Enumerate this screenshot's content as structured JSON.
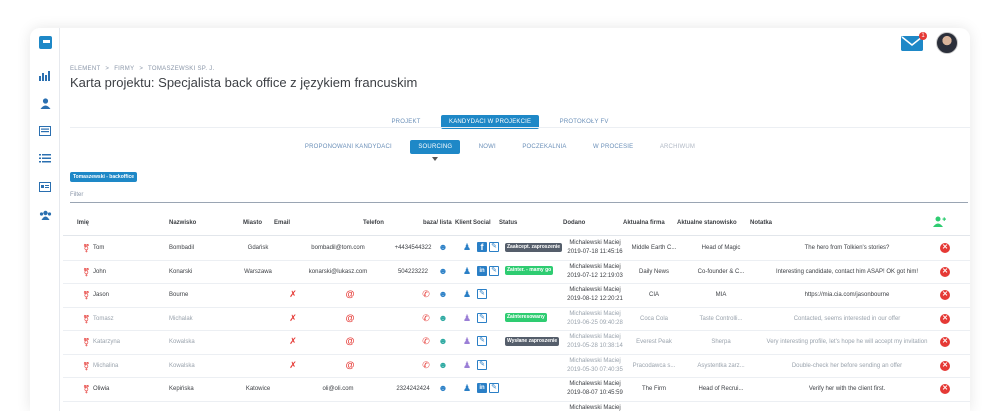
{
  "sidebar": {
    "icons": [
      "chart-icon",
      "user-icon",
      "card-icon",
      "list-icon",
      "id-card-icon",
      "group-icon"
    ]
  },
  "header": {
    "notifications_count": "1"
  },
  "breadcrumb": [
    "ELEMENT",
    ">",
    "FIRMY",
    ">",
    "TOMASZEWSKI SP. J."
  ],
  "page_title": "Karta projektu: Specjalista back office z językiem francuskim",
  "main_tabs": [
    {
      "label": "PROJEKT",
      "active": false
    },
    {
      "label": "KANDYDACI W PROJEKCIE",
      "active": true
    },
    {
      "label": "PROTOKOŁY FV",
      "active": false
    }
  ],
  "sub_tabs": [
    {
      "label": "PROPONOWANI KANDYDACI",
      "state": ""
    },
    {
      "label": "SOURCING",
      "state": "active"
    },
    {
      "label": "NOWI",
      "state": ""
    },
    {
      "label": "POCZEKALNIA",
      "state": ""
    },
    {
      "label": "W PROCESIE",
      "state": ""
    },
    {
      "label": "ARCHIWUM",
      "state": "dim"
    }
  ],
  "project_tag": "Tomaszewski - backoffice",
  "filter_placeholder": "Filter",
  "columns": [
    "Imię",
    "Nazwisko",
    "Miasto",
    "Email",
    "Telefon",
    "baza/ lista",
    "Klient",
    "Social",
    "Status",
    "Dodano",
    "Aktualna firma",
    "Aktualne stanowisko",
    "Notatka"
  ],
  "rows": [
    {
      "first": "Tom",
      "last": "Bombadil",
      "city": "Gdańsk",
      "email": "bombadil@tom.com",
      "phone": "+4434544322",
      "social": [
        "facebook",
        "edit"
      ],
      "status": "Zaakcept. zaproszenie",
      "status_color": "#555e6b",
      "added_by": "Michalewski Maciej",
      "added_at": "2019-07-18 11:45:16",
      "company": "Middle Earth C...",
      "position": "Head of Magic",
      "note": "The hero from Tolkien's stories?",
      "faded": false
    },
    {
      "first": "John",
      "last": "Konarski",
      "city": "Warszawa",
      "email": "konarski@lukasz.com",
      "phone": "504223222",
      "social": [
        "linkedin",
        "edit"
      ],
      "status": "Zainter. - mamy go",
      "status_color": "#2ecc71",
      "added_by": "Michalewski Maciej",
      "added_at": "2019-07-12 12:19:03",
      "company": "Daily News",
      "position": "Co-founder & C...",
      "note": "Interesting candidate, contact him ASAP! OK got him!",
      "faded": false
    },
    {
      "first": "Jason",
      "last": "Bourne",
      "city": "",
      "email": "",
      "phone": "",
      "social": [
        "edit"
      ],
      "status": "",
      "status_color": "",
      "added_by": "Michalewski Maciej",
      "added_at": "2019-08-12 12:20:21",
      "company": "CIA",
      "position": "MIA",
      "note": "https://mia.cia.com/jasonbourne",
      "faded": false
    },
    {
      "first": "Tomasz",
      "last": "Michalak",
      "city": "",
      "email": "",
      "phone": "",
      "social": [
        "edit"
      ],
      "status": "Zainteresowany",
      "status_color": "#2ecc71",
      "added_by": "Michalewski Maciej",
      "added_at": "2019-06-25 09:40:28",
      "company": "Coca Cola",
      "position": "Taste Controlli...",
      "note": "Contacted, seems interested in our offer",
      "faded": true
    },
    {
      "first": "Katarzyna",
      "last": "Kowalska",
      "city": "",
      "email": "",
      "phone": "",
      "social": [
        "edit"
      ],
      "status": "Wysłane zaproszenie",
      "status_color": "#555e6b",
      "added_by": "Michalewski Maciej",
      "added_at": "2019-05-28 10:38:14",
      "company": "Everest Peak",
      "position": "Sherpa",
      "note": "Very interesting profile, let's hope he will accept my invitation",
      "faded": true
    },
    {
      "first": "Michalina",
      "last": "Kowalska",
      "city": "",
      "email": "",
      "phone": "",
      "social": [
        "edit"
      ],
      "status": "",
      "status_color": "",
      "added_by": "Michalewski Maciej",
      "added_at": "2019-05-30 07:40:35",
      "company": "Pracodawca s...",
      "position": "Asystentka zarz...",
      "note": "Double-check her before sending an offer",
      "faded": true
    },
    {
      "first": "Oliwia",
      "last": "Kepińska",
      "city": "Katowice",
      "email": "oli@oli.com",
      "phone": "2324242424",
      "social": [
        "linkedin",
        "edit"
      ],
      "status": "",
      "status_color": "",
      "added_by": "Michalewski Maciej",
      "added_at": "2019-08-07 10:45:59",
      "company": "The Firm",
      "position": "Head of Recrui...",
      "note": "Verify her with the client first.",
      "faded": false
    },
    {
      "first": "",
      "last": "",
      "city": "",
      "email": "",
      "phone": "",
      "social": [],
      "status": "",
      "status_color": "",
      "added_by": "Michalewski Maciej",
      "added_at": "",
      "company": "",
      "position": "",
      "note": "",
      "faded": false
    }
  ],
  "colors": {
    "accent": "#1e88c7",
    "danger": "#e53935",
    "success": "#2ecc71"
  }
}
